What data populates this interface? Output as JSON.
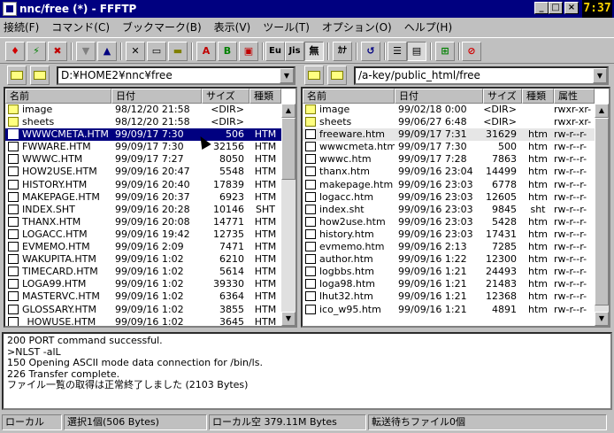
{
  "window": {
    "title": "nnc/free (*) - FFFTP",
    "clock": "7:37"
  },
  "menu": [
    "接続(F)",
    "コマンド(C)",
    "ブックマーク(B)",
    "表示(V)",
    "ツール(T)",
    "オプション(O)",
    "ヘルプ(H)"
  ],
  "toolbar": {
    "eng_label": "Eu",
    "jis_label": "Jis",
    "mu_label": "無",
    "kana_label": "ｶﾅ"
  },
  "local": {
    "path": "D:¥HOME2¥nnc¥free",
    "cols": [
      "名前",
      "日付",
      "サイズ",
      "種類"
    ],
    "rows": [
      {
        "n": "image",
        "d": "98/12/20 21:58",
        "s": "<DIR>",
        "t": "",
        "k": "dir"
      },
      {
        "n": "sheets",
        "d": "98/12/20 21:58",
        "s": "<DIR>",
        "t": "",
        "k": "dir"
      },
      {
        "n": "WWWCMETA.HTM",
        "d": "99/09/17  7:30",
        "s": "506",
        "t": "HTM",
        "k": "file",
        "sel": true
      },
      {
        "n": "FWWARE.HTM",
        "d": "99/09/17  7:30",
        "s": "32156",
        "t": "HTM",
        "k": "file"
      },
      {
        "n": "WWWC.HTM",
        "d": "99/09/17  7:27",
        "s": "8050",
        "t": "HTM",
        "k": "file"
      },
      {
        "n": "HOW2USE.HTM",
        "d": "99/09/16 20:47",
        "s": "5548",
        "t": "HTM",
        "k": "file"
      },
      {
        "n": "HISTORY.HTM",
        "d": "99/09/16 20:40",
        "s": "17839",
        "t": "HTM",
        "k": "file"
      },
      {
        "n": "MAKEPAGE.HTM",
        "d": "99/09/16 20:37",
        "s": "6923",
        "t": "HTM",
        "k": "file"
      },
      {
        "n": "INDEX.SHT",
        "d": "99/09/16 20:28",
        "s": "10146",
        "t": "SHT",
        "k": "file"
      },
      {
        "n": "THANX.HTM",
        "d": "99/09/16 20:08",
        "s": "14771",
        "t": "HTM",
        "k": "file"
      },
      {
        "n": "LOGACC.HTM",
        "d": "99/09/16 19:42",
        "s": "12735",
        "t": "HTM",
        "k": "file"
      },
      {
        "n": "EVMEMO.HTM",
        "d": "99/09/16  2:09",
        "s": "7471",
        "t": "HTM",
        "k": "file"
      },
      {
        "n": "WAKUPITA.HTM",
        "d": "99/09/16  1:02",
        "s": "6210",
        "t": "HTM",
        "k": "file"
      },
      {
        "n": "TIMECARD.HTM",
        "d": "99/09/16  1:02",
        "s": "5614",
        "t": "HTM",
        "k": "file"
      },
      {
        "n": "LOGA99.HTM",
        "d": "99/09/16  1:02",
        "s": "39330",
        "t": "HTM",
        "k": "file"
      },
      {
        "n": "MASTERVC.HTM",
        "d": "99/09/16  1:02",
        "s": "6364",
        "t": "HTM",
        "k": "file"
      },
      {
        "n": "GLOSSARY.HTM",
        "d": "99/09/16  1:02",
        "s": "3855",
        "t": "HTM",
        "k": "file"
      },
      {
        "n": "_HOWUSE.HTM",
        "d": "99/09/16  1:02",
        "s": "3645",
        "t": "HTM",
        "k": "file"
      }
    ]
  },
  "remote": {
    "path": "/a-key/public_html/free",
    "cols": [
      "名前",
      "日付",
      "サイズ",
      "種類",
      "属性"
    ],
    "rows": [
      {
        "n": "image",
        "d": "99/02/18  0:00",
        "s": "<DIR>",
        "t": "",
        "a": "rwxr-xr-",
        "k": "dir"
      },
      {
        "n": "sheets",
        "d": "99/06/27  6:48",
        "s": "<DIR>",
        "t": "",
        "a": "rwxr-xr-",
        "k": "dir"
      },
      {
        "n": "freeware.htm",
        "d": "99/09/17  7:31",
        "s": "31629",
        "t": "htm",
        "a": "rw-r--r-",
        "k": "file",
        "hl": true
      },
      {
        "n": "wwwcmeta.htm",
        "d": "99/09/17  7:30",
        "s": "500",
        "t": "htm",
        "a": "rw-r--r-",
        "k": "file"
      },
      {
        "n": "wwwc.htm",
        "d": "99/09/17  7:28",
        "s": "7863",
        "t": "htm",
        "a": "rw-r--r-",
        "k": "file"
      },
      {
        "n": "thanx.htm",
        "d": "99/09/16 23:04",
        "s": "14499",
        "t": "htm",
        "a": "rw-r--r-",
        "k": "file"
      },
      {
        "n": "makepage.htm",
        "d": "99/09/16 23:03",
        "s": "6778",
        "t": "htm",
        "a": "rw-r--r-",
        "k": "file"
      },
      {
        "n": "logacc.htm",
        "d": "99/09/16 23:03",
        "s": "12605",
        "t": "htm",
        "a": "rw-r--r-",
        "k": "file"
      },
      {
        "n": "index.sht",
        "d": "99/09/16 23:03",
        "s": "9845",
        "t": "sht",
        "a": "rw-r--r-",
        "k": "file"
      },
      {
        "n": "how2use.htm",
        "d": "99/09/16 23:03",
        "s": "5428",
        "t": "htm",
        "a": "rw-r--r-",
        "k": "file"
      },
      {
        "n": "history.htm",
        "d": "99/09/16 23:03",
        "s": "17431",
        "t": "htm",
        "a": "rw-r--r-",
        "k": "file"
      },
      {
        "n": "evmemo.htm",
        "d": "99/09/16  2:13",
        "s": "7285",
        "t": "htm",
        "a": "rw-r--r-",
        "k": "file"
      },
      {
        "n": "author.htm",
        "d": "99/09/16  1:22",
        "s": "12300",
        "t": "htm",
        "a": "rw-r--r-",
        "k": "file"
      },
      {
        "n": "logbbs.htm",
        "d": "99/09/16  1:21",
        "s": "24493",
        "t": "htm",
        "a": "rw-r--r-",
        "k": "file"
      },
      {
        "n": "loga98.htm",
        "d": "99/09/16  1:21",
        "s": "21483",
        "t": "htm",
        "a": "rw-r--r-",
        "k": "file"
      },
      {
        "n": "lhut32.htm",
        "d": "99/09/16  1:21",
        "s": "12368",
        "t": "htm",
        "a": "rw-r--r-",
        "k": "file"
      },
      {
        "n": "ico_w95.htm",
        "d": "99/09/16  1:21",
        "s": "4891",
        "t": "htm",
        "a": "rw-r--r-",
        "k": "file"
      }
    ]
  },
  "log": [
    "200 PORT command successful.",
    ">NLST -alL",
    "150 Opening ASCII mode data connection for /bin/ls.",
    "226 Transfer complete.",
    "ファイル一覧の取得は正常終了しました (2103 Bytes)"
  ],
  "status": {
    "mode": "ローカル",
    "selection": "選択1個(506 Bytes)",
    "free": "ローカル空 379.11M Bytes",
    "queue": "転送待ちファイル0個"
  }
}
